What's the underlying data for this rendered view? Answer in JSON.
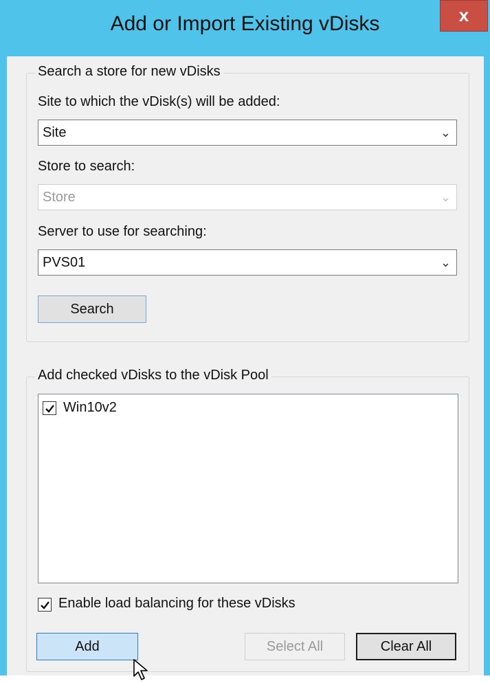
{
  "window": {
    "title": "Add or Import Existing vDisks",
    "close_glyph": "x"
  },
  "search_group": {
    "legend": "Search a store for new vDisks",
    "site_label": "Site to which the vDisk(s) will be added:",
    "site_value": "Site",
    "store_label": "Store to search:",
    "store_value": "Store",
    "server_label": "Server to use for searching:",
    "server_value": "PVS01",
    "search_button": "Search"
  },
  "pool_group": {
    "legend": "Add checked vDisks to the vDisk Pool",
    "items": [
      {
        "label": "Win10v2",
        "checked": true
      }
    ],
    "load_balancing_label": "Enable load balancing for these vDisks",
    "load_balancing_checked": true
  },
  "buttons": {
    "add": "Add",
    "select_all": "Select All",
    "clear_all": "Clear All"
  },
  "icons": {
    "dropdown": "chevron-down-icon",
    "close": "close-icon",
    "check": "check-icon",
    "cursor": "mouse-pointer-icon"
  },
  "colors": {
    "titlebar": "#4fc3ea",
    "close": "#c94f45",
    "hover": "#cce4f7"
  }
}
